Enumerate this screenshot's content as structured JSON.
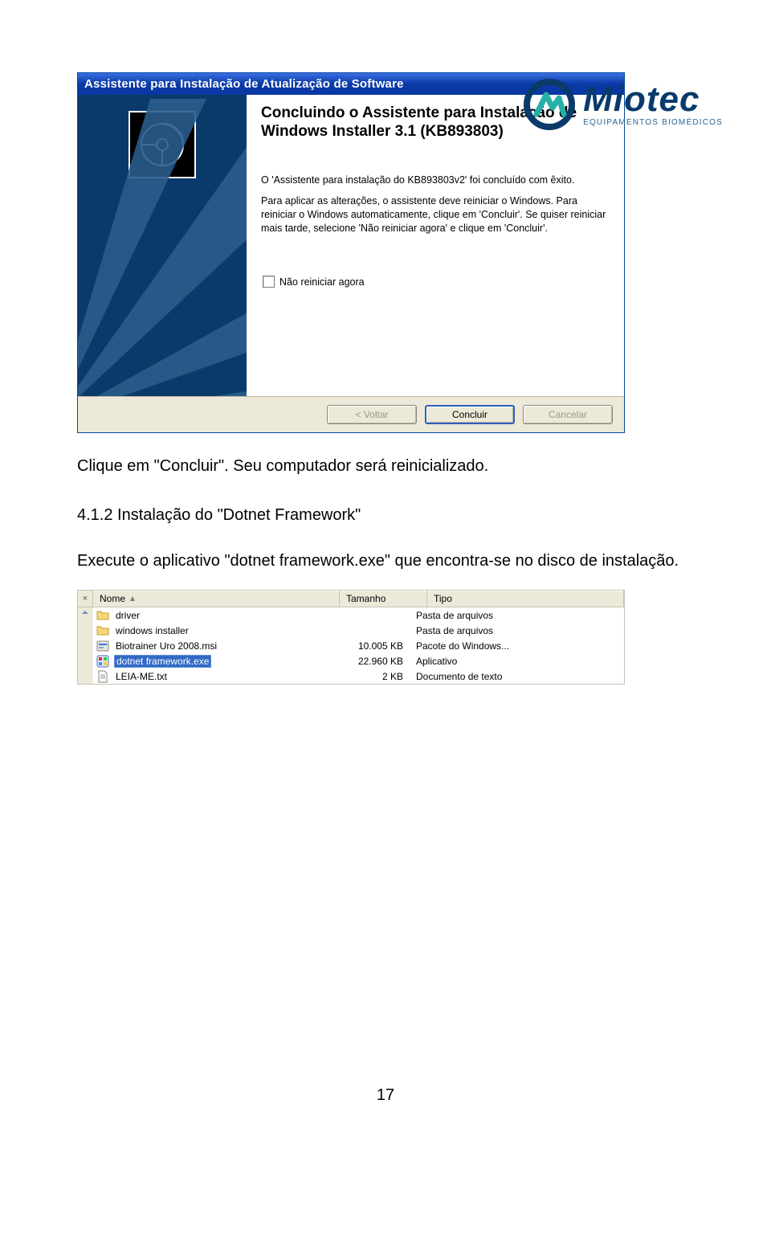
{
  "logo": {
    "brand": "Miotec",
    "sub": "EQUIPAMENTOS BIOMÉDICOS"
  },
  "wizard": {
    "title": "Assistente para Instalação de Atualização de Software",
    "heading": "Concluindo o Assistente para Instalação de Windows Installer 3.1 (KB893803)",
    "para1": "O 'Assistente para instalação do KB893803v2' foi concluído com êxito.",
    "para2": "Para aplicar as alterações, o assistente deve reiniciar o Windows. Para reiniciar o Windows automaticamente, clique em 'Concluir'. Se quiser reiniciar mais tarde, selecione 'Não reiniciar agora' e clique em 'Concluir'.",
    "checkbox_label": "Não reiniciar agora",
    "buttons": {
      "back": "< Voltar",
      "finish": "Concluir",
      "cancel": "Cancelar"
    }
  },
  "doc": {
    "line1": "Clique em \"Concluir\". Seu computador será reinicializado.",
    "heading": "4.1.2 Instalação do \"Dotnet Framework\"",
    "para": "Execute o aplicativo \"dotnet framework.exe\" que encontra-se no disco de instalação."
  },
  "filelist": {
    "columns": {
      "name": "Nome",
      "size": "Tamanho",
      "type": "Tipo"
    },
    "rows": [
      {
        "icon": "folder",
        "name": "driver",
        "size": "",
        "type": "Pasta de arquivos",
        "selected": false
      },
      {
        "icon": "folder",
        "name": "windows installer",
        "size": "",
        "type": "Pasta de arquivos",
        "selected": false
      },
      {
        "icon": "msi",
        "name": "Biotrainer Uro 2008.msi",
        "size": "10.005 KB",
        "type": "Pacote do Windows...",
        "selected": false
      },
      {
        "icon": "exe",
        "name": "dotnet framework.exe",
        "size": "22.960 KB",
        "type": "Aplicativo",
        "selected": true
      },
      {
        "icon": "txt",
        "name": "LEIA-ME.txt",
        "size": "2 KB",
        "type": "Documento de texto",
        "selected": false
      }
    ]
  },
  "page_number": "17"
}
